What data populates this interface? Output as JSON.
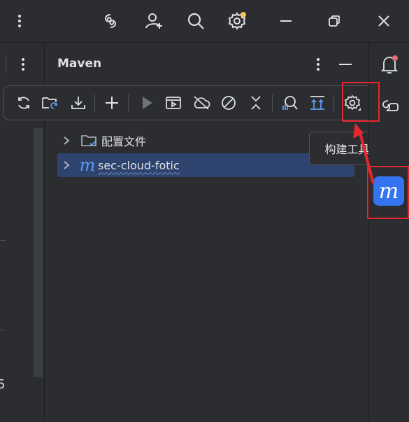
{
  "panel": {
    "title": "Maven"
  },
  "tree": {
    "items": [
      {
        "label": "配置文件",
        "icon": "folder-icon"
      },
      {
        "label": "sec-cloud-fotic",
        "icon": "maven-module-icon",
        "icon_letter": "m",
        "selected": true
      }
    ]
  },
  "tooltip": {
    "text": "构建工具设置"
  },
  "toolbar": {
    "tools": [
      "reload-all-icon",
      "reload-project-icon",
      "download-icon",
      "add-icon",
      "run-icon",
      "execute-goal-icon",
      "offline-mode-icon",
      "skip-tests-icon",
      "collapse-all-icon",
      "analyze-dependencies-icon",
      "show-dependencies-icon",
      "build-tool-settings-icon"
    ]
  },
  "sidebar_right": {
    "maven_letter": "m"
  },
  "left_strip": {
    "digit": "5"
  },
  "colors": {
    "accent": "#3574f0",
    "highlight": "#e5262f",
    "selected_row": "#2e436e",
    "notification_dot": "#e06c75",
    "settings_dot": "#f2c55c"
  }
}
